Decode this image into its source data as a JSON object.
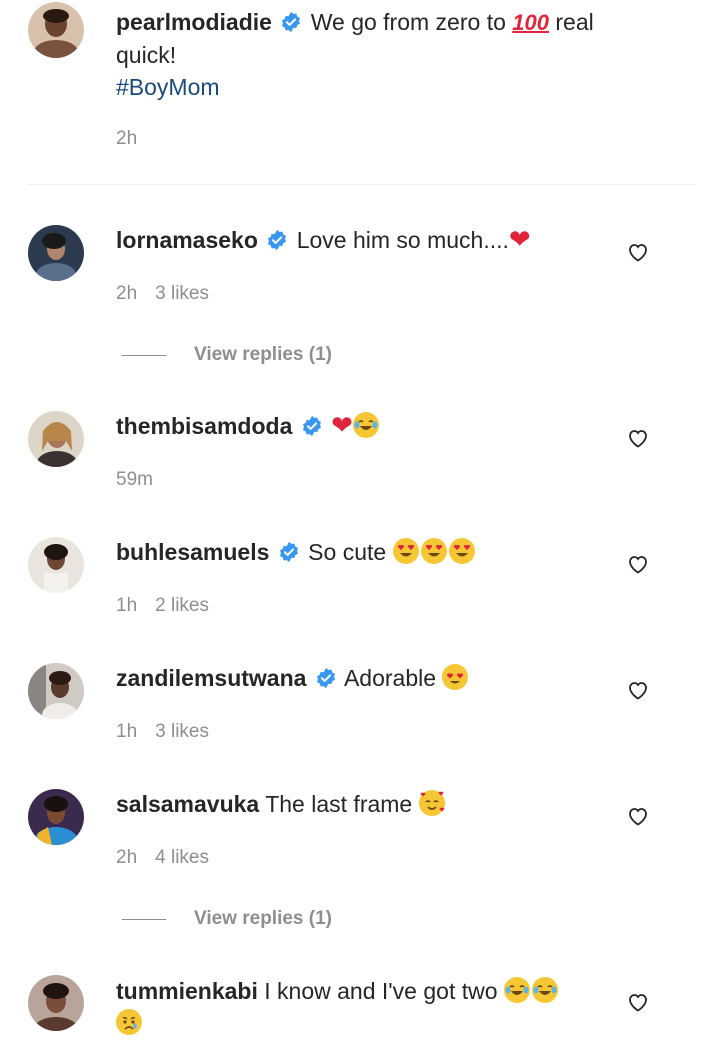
{
  "caption": {
    "username": "pearlmodiadie",
    "text_before": "We go from zero to",
    "emoji_100": "100",
    "text_after": "real quick!",
    "hashtag": "#BoyMom",
    "time": "2h"
  },
  "comments": [
    {
      "username": "lornamaseko",
      "text": "Love him so much....",
      "time": "2h",
      "likes": "3 likes",
      "replies": "View replies (1)"
    },
    {
      "username": "thembisamdoda",
      "text": "",
      "time": "59m",
      "likes": ""
    },
    {
      "username": "buhlesamuels",
      "text": "So cute",
      "time": "1h",
      "likes": "2 likes"
    },
    {
      "username": "zandilemsutwana",
      "text": "Adorable",
      "time": "1h",
      "likes": "3 likes"
    },
    {
      "username": "salsamavuka",
      "text": "The last frame",
      "time": "2h",
      "likes": "4 likes",
      "replies": "View replies (1)"
    },
    {
      "username": "tummienkabi",
      "text": "I know and I've got two",
      "time": "",
      "likes": ""
    }
  ],
  "colors": {
    "verified": "#3897f0",
    "hashtag": "#1a4a7a",
    "meta": "#8e8e8e",
    "text": "#262626"
  },
  "icons": {
    "like": "heart-outline-icon",
    "verified": "verified-badge-icon"
  }
}
